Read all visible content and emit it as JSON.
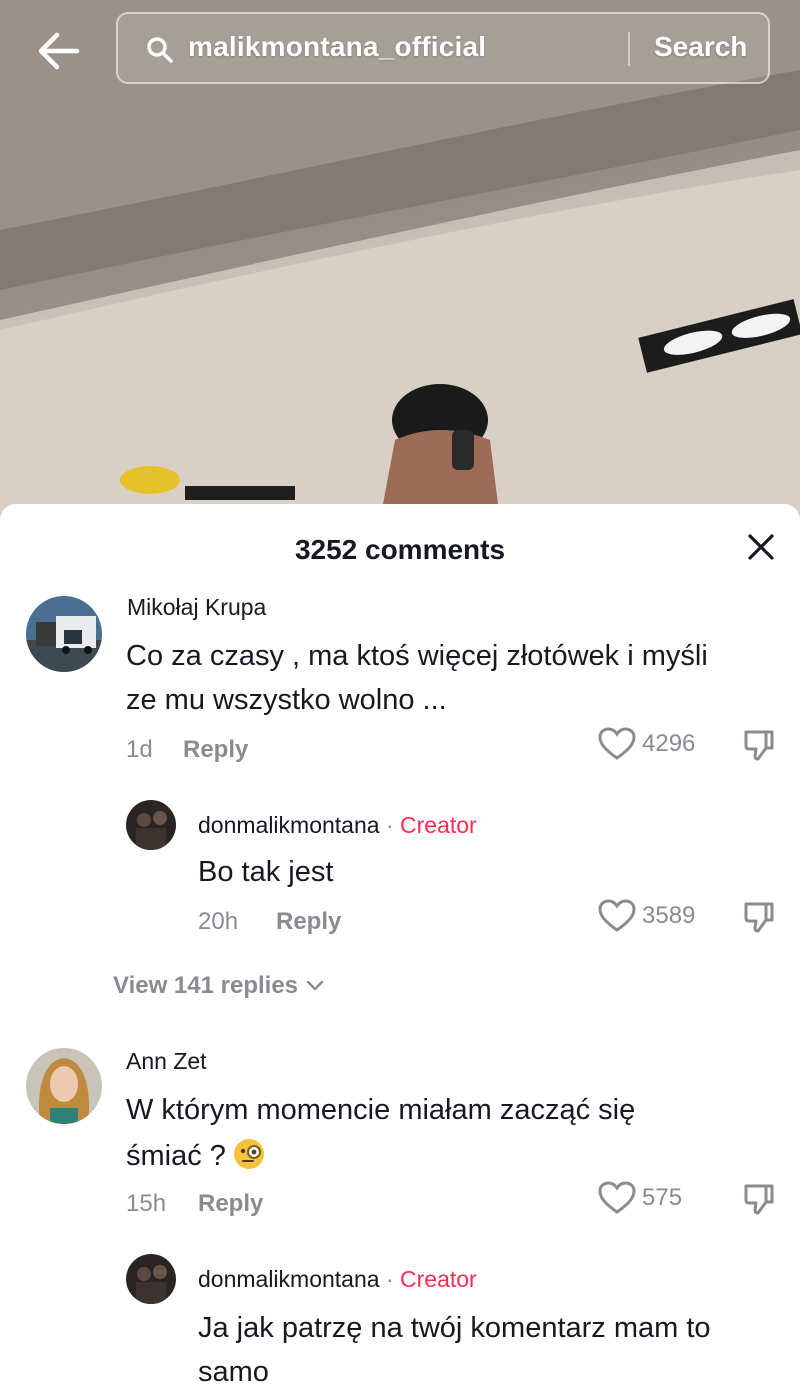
{
  "search": {
    "query": "malikmontana_official",
    "button_label": "Search"
  },
  "comments_panel": {
    "title": "3252 comments",
    "close_icon": "close-icon"
  },
  "comments": [
    {
      "author": "Mikołaj Krupa",
      "text_line1": "Co za czasy , ma ktoś więcej złotówek i myśli",
      "text_line2": "ze mu wszystko wolno ...",
      "time": "1d",
      "reply_label": "Reply",
      "likes": "4296",
      "reply": {
        "author": "donmalikmontana",
        "separator": "·",
        "badge": "Creator",
        "text_line1": "Bo tak jest",
        "time": "20h",
        "reply_label": "Reply",
        "likes": "3589"
      },
      "view_replies": "View 141 replies"
    },
    {
      "author": "Ann Zet",
      "text_line1": "W którym momencie miałam zacząć się",
      "text_line2": "śmiać ?",
      "time": "15h",
      "reply_label": "Reply",
      "likes": "575",
      "reply": {
        "author": "donmalikmontana",
        "separator": "·",
        "badge": "Creator",
        "text_line1": "Ja jak patrzę na twój komentarz mam to",
        "text_line2": "samo"
      }
    }
  ],
  "colors": {
    "creator_badge": "#fe2c55",
    "text_primary": "#161823",
    "text_secondary": "#8a8b91"
  }
}
